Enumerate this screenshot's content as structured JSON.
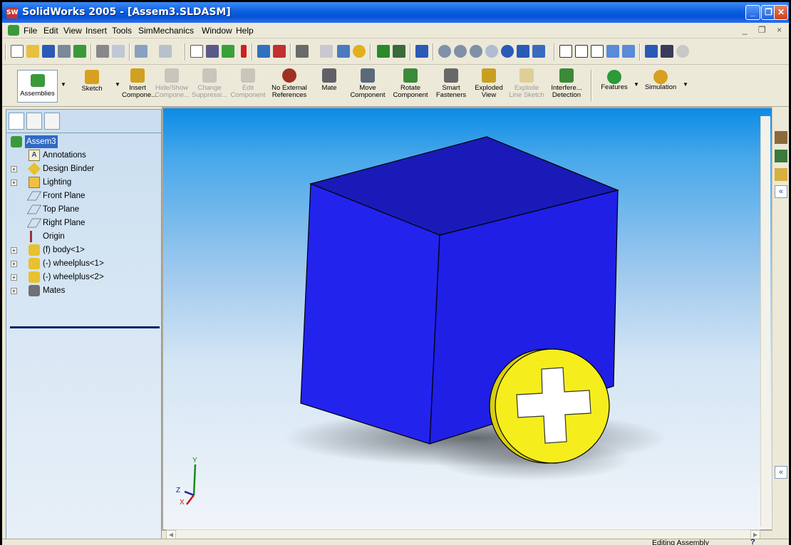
{
  "window": {
    "title": "SolidWorks 2005 - [Assem3.SLDASM]",
    "app_icon_text": "SW"
  },
  "window_buttons": {
    "minimize": "_",
    "maximize": "❐",
    "close": "✕"
  },
  "menu": [
    "File",
    "Edit",
    "View",
    "Insert",
    "Tools",
    "SimMechanics",
    "Window",
    "Help"
  ],
  "doc_controls": "_ ❐ ×",
  "command_manager": {
    "tab_assemblies": "Assemblies",
    "sketch": "Sketch",
    "insert_component": [
      "Insert",
      "Compone..."
    ],
    "hide_show": [
      "Hide/Show",
      "Compone..."
    ],
    "change_suppression": [
      "Change",
      "Suppressi..."
    ],
    "edit_component": [
      "Edit",
      "Component"
    ],
    "no_external_refs": [
      "No External",
      "References"
    ],
    "mate": [
      "Mate",
      ""
    ],
    "move_component": [
      "Move",
      "Component"
    ],
    "rotate_component": [
      "Rotate",
      "Component"
    ],
    "smart_fasteners": [
      "Smart",
      "Fasteners"
    ],
    "exploded_view": [
      "Exploded",
      "View"
    ],
    "explode_line_sketch": [
      "Explode",
      "Line Sketch"
    ],
    "interference_detection": [
      "Interfere...",
      "Detection"
    ],
    "features": "Features",
    "simulation": "Simulation"
  },
  "tree": {
    "root": "Assem3",
    "items": [
      {
        "label": "Annotations",
        "icon": "annotations-icon",
        "expand": false
      },
      {
        "label": "Design Binder",
        "icon": "design-binder-icon",
        "expand": true
      },
      {
        "label": "Lighting",
        "icon": "lighting-icon",
        "expand": true
      },
      {
        "label": "Front Plane",
        "icon": "plane-icon",
        "expand": false
      },
      {
        "label": "Top Plane",
        "icon": "plane-icon",
        "expand": false
      },
      {
        "label": "Right Plane",
        "icon": "plane-icon",
        "expand": false
      },
      {
        "label": "Origin",
        "icon": "origin-icon",
        "expand": false
      },
      {
        "label": "(f) body<1>",
        "icon": "part-icon",
        "expand": true
      },
      {
        "label": "(-) wheelplus<1>",
        "icon": "part-icon",
        "expand": true
      },
      {
        "label": "(-) wheelplus<2>",
        "icon": "part-icon",
        "expand": true
      },
      {
        "label": "Mates",
        "icon": "mates-icon",
        "expand": true
      }
    ]
  },
  "triad": {
    "x": "X",
    "y": "Y",
    "z": "Z"
  },
  "status": {
    "text": "Editing Assembly",
    "help": "?"
  },
  "colors": {
    "body": "#1f1fe6",
    "wheel": "#f5ee1c",
    "titlebar": "#0453d6",
    "viewport_top": "#0a8ae6"
  }
}
